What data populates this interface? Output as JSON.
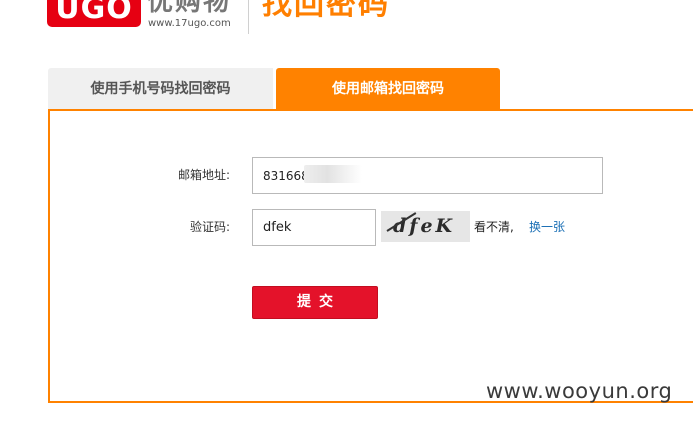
{
  "header": {
    "logo_text": "UGO",
    "logo_cn": "优购物",
    "logo_url": "www.17ugo.com",
    "page_title": "找回密码"
  },
  "tabs": [
    {
      "label": "使用手机号码找回密码",
      "active": false
    },
    {
      "label": "使用邮箱找回密码",
      "active": true
    }
  ],
  "form": {
    "email_label": "邮箱地址:",
    "email_value": "831668",
    "captcha_label": "验证码:",
    "captcha_value": "dfek",
    "captcha_image_text": "dfeK",
    "unclear_text": "看不清,",
    "refresh_label": "换一张",
    "submit_label": "提交"
  },
  "watermark": "www.wooyun.org",
  "colors": {
    "accent_orange": "#ff8200",
    "brand_red": "#e60012",
    "submit_red": "#e4122a",
    "link_blue": "#1a6fb5"
  }
}
